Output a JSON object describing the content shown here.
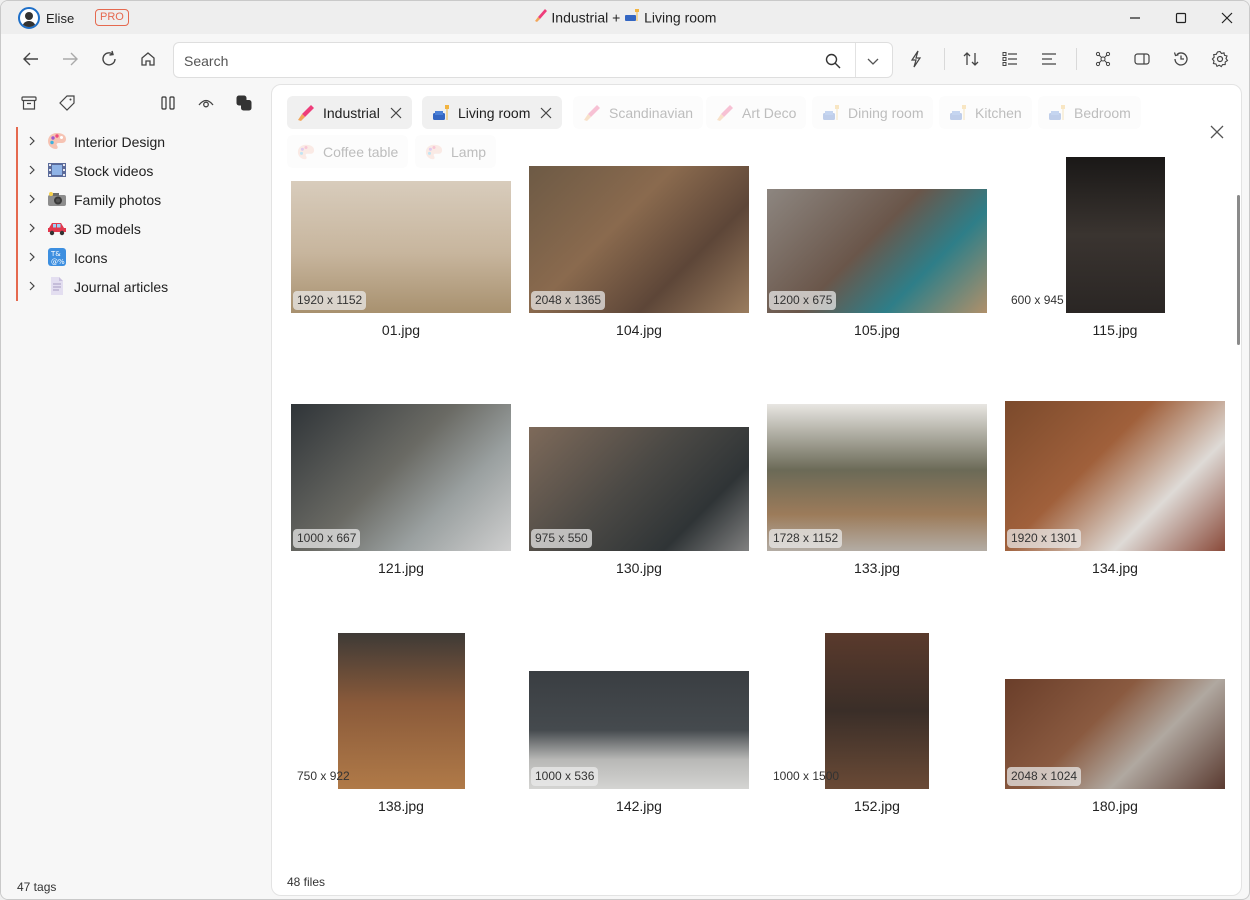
{
  "titlebar": {
    "user_name": "Elise",
    "badge": "PRO",
    "title_tag_1": "Industrial",
    "title_join": "+",
    "title_tag_2": "Living room",
    "controls": [
      "minimize-icon",
      "maximize-icon",
      "close-icon"
    ]
  },
  "toolbar": {
    "nav": [
      "back-icon",
      "forward-icon",
      "refresh-icon",
      "home-icon"
    ],
    "search_placeholder": "Search",
    "search_value": "",
    "right_icons": [
      "lightning-icon",
      "sort-icon",
      "checklist-icon",
      "align-left-icon",
      "graph-icon",
      "panel-icon",
      "history-icon",
      "settings-icon"
    ]
  },
  "sidebar": {
    "tools": [
      "archive-icon",
      "tag-icon",
      "columns-icon",
      "eye-icon",
      "layers-icon"
    ],
    "items": [
      {
        "label": "Interior Design",
        "icon": "palette-icon"
      },
      {
        "label": "Stock videos",
        "icon": "film-icon"
      },
      {
        "label": "Family photos",
        "icon": "camera-icon"
      },
      {
        "label": "3D models",
        "icon": "car-icon"
      },
      {
        "label": "Icons",
        "icon": "symbols-icon"
      },
      {
        "label": "Journal articles",
        "icon": "document-icon"
      }
    ],
    "footer": "47 tags"
  },
  "filters": {
    "chips": [
      {
        "label": "Industrial",
        "active": true,
        "icon": "brush-icon"
      },
      {
        "label": "Living room",
        "active": true,
        "icon": "sofa-icon"
      },
      {
        "label": "Scandinavian",
        "active": false,
        "icon": "brush-icon"
      },
      {
        "label": "Art Deco",
        "active": false,
        "icon": "brush-icon"
      },
      {
        "label": "Dining room",
        "active": false,
        "icon": "sofa-icon"
      },
      {
        "label": "Kitchen",
        "active": false,
        "icon": "sofa-icon"
      },
      {
        "label": "Bedroom",
        "active": false,
        "icon": "sofa-icon"
      },
      {
        "label": "Coffee table",
        "active": false,
        "icon": "palette-icon"
      },
      {
        "label": "Lamp",
        "active": false,
        "icon": "palette-icon"
      }
    ]
  },
  "files": [
    {
      "name": "01.jpg",
      "dims": "1920 x 1152"
    },
    {
      "name": "104.jpg",
      "dims": "2048 x 1365"
    },
    {
      "name": "105.jpg",
      "dims": "1200 x 675"
    },
    {
      "name": "115.jpg",
      "dims": "600 x 945"
    },
    {
      "name": "121.jpg",
      "dims": "1000 x 667"
    },
    {
      "name": "130.jpg",
      "dims": "975 x 550"
    },
    {
      "name": "133.jpg",
      "dims": "1728 x 1152"
    },
    {
      "name": "134.jpg",
      "dims": "1920 x 1301"
    },
    {
      "name": "138.jpg",
      "dims": "750 x 922"
    },
    {
      "name": "142.jpg",
      "dims": "1000 x 536"
    },
    {
      "name": "152.jpg",
      "dims": "1000 x 1500"
    },
    {
      "name": "180.jpg",
      "dims": "2048 x 1024"
    }
  ],
  "main_footer": "48 files",
  "colors": {
    "accent": "#e5694f",
    "user_ring": "#1e6fc8"
  }
}
